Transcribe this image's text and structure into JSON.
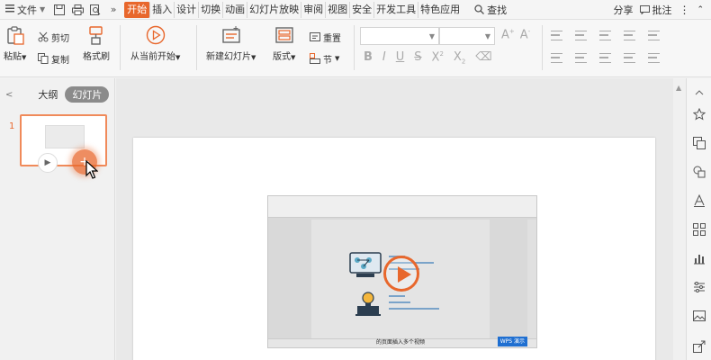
{
  "menu": {
    "file_label": "文件",
    "tabs": [
      "开始",
      "插入",
      "设计",
      "切换",
      "动画",
      "幻灯片放映",
      "审阅",
      "视图",
      "安全",
      "开发工具",
      "特色应用"
    ],
    "active_tab": "开始",
    "search_label": "查找",
    "share_label": "分享",
    "comment_label": "批注"
  },
  "ribbon": {
    "paste_label": "粘贴",
    "cut_label": "剪切",
    "copy_label": "复制",
    "format_painter_label": "格式刷",
    "from_current_label": "从当前开始",
    "new_slide_label": "新建幻灯片",
    "layout_label": "版式",
    "reset_label": "重置",
    "section_label": "节"
  },
  "left_panel": {
    "outline_tab": "大纲",
    "slides_tab": "幻灯片",
    "slide_number": "1"
  },
  "media": {
    "caption": "的页面插入多个视频",
    "badge": "WPS 演示"
  },
  "colors": {
    "accent": "#e8672c",
    "badge_blue": "#1f6fd1"
  }
}
